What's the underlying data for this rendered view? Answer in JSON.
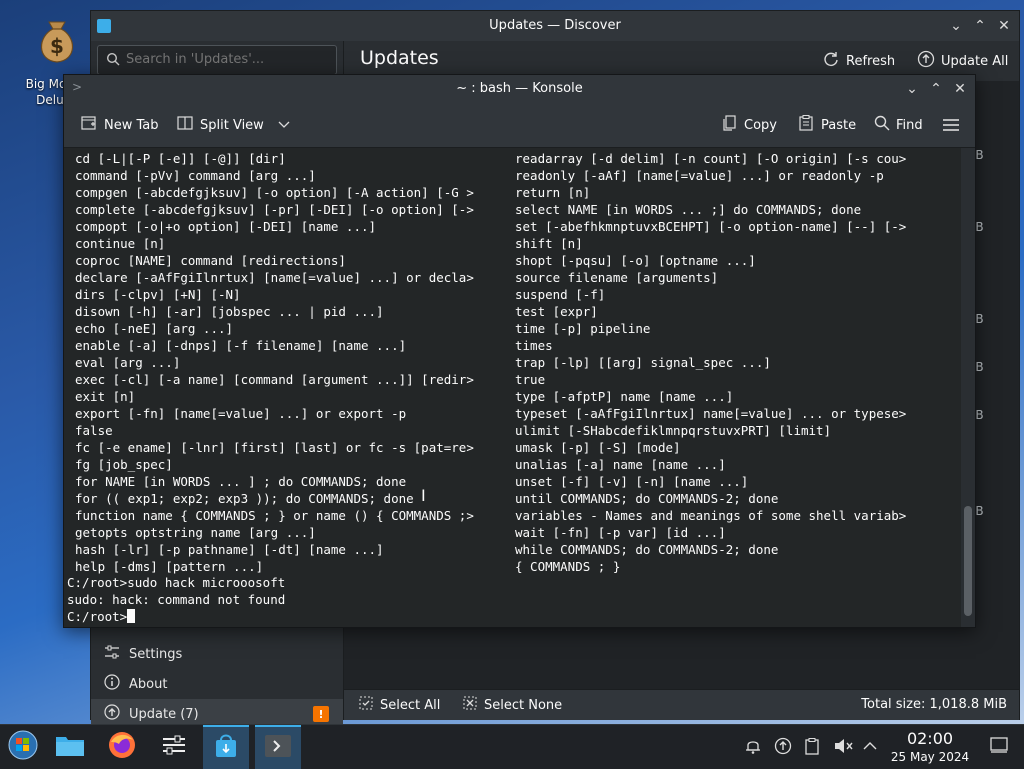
{
  "desktop": {
    "icon_label": "Big Money\nDeluxe"
  },
  "discover": {
    "title": "Updates — Discover",
    "search_placeholder": "Search in 'Updates'...",
    "header_title": "Updates",
    "refresh_label": "Refresh",
    "update_all_label": "Update All",
    "sidebar": {
      "settings_label": "Settings",
      "about_label": "About",
      "update_label": "Update (7)",
      "warning_glyph": "!"
    },
    "bottom": {
      "select_all_label": "Select All",
      "select_none_label": "Select None",
      "total_size": "Total size: 1,018.8 MiB"
    },
    "size_fragments": [
      "iB",
      "iB",
      "iB",
      "iB",
      "iB",
      "iB"
    ]
  },
  "konsole": {
    "title": "~ : bash — Konsole",
    "toolbar": {
      "new_tab": "New Tab",
      "split_view": "Split View",
      "copy": "Copy",
      "paste": "Paste",
      "find": "Find"
    },
    "col1": [
      "cd [-L|[-P [-e]] [-@]] [dir]",
      "command [-pVv] command [arg ...]",
      "compgen [-abcdefgjksuv] [-o option] [-A action] [-G >",
      "complete [-abcdefgjksuv] [-pr] [-DEI] [-o option] [->",
      "compopt [-o|+o option] [-DEI] [name ...]",
      "continue [n]",
      "coproc [NAME] command [redirections]",
      "declare [-aAfFgiIlnrtux] [name[=value] ...] or decla>",
      "dirs [-clpv] [+N] [-N]",
      "disown [-h] [-ar] [jobspec ... | pid ...]",
      "echo [-neE] [arg ...]",
      "enable [-a] [-dnps] [-f filename] [name ...]",
      "eval [arg ...]",
      "exec [-cl] [-a name] [command [argument ...]] [redir>",
      "exit [n]",
      "export [-fn] [name[=value] ...] or export -p",
      "false",
      "fc [-e ename] [-lnr] [first] [last] or fc -s [pat=re>",
      "fg [job_spec]",
      "for NAME [in WORDS ... ] ; do COMMANDS; done",
      "for (( exp1; exp2; exp3 )); do COMMANDS; done",
      "function name { COMMANDS ; } or name () { COMMANDS ;>",
      "getopts optstring name [arg ...]",
      "hash [-lr] [-p pathname] [-dt] [name ...]",
      "help [-dms] [pattern ...]"
    ],
    "col2": [
      "readarray [-d delim] [-n count] [-O origin] [-s cou>",
      "readonly [-aAf] [name[=value] ...] or readonly -p",
      "return [n]",
      "select NAME [in WORDS ... ;] do COMMANDS; done",
      "set [-abefhkmnptuvxBCEHPT] [-o option-name] [--] [->",
      "shift [n]",
      "shopt [-pqsu] [-o] [optname ...]",
      "source filename [arguments]",
      "suspend [-f]",
      "test [expr]",
      "time [-p] pipeline",
      "times",
      "trap [-lp] [[arg] signal_spec ...]",
      "true",
      "type [-afptP] name [name ...]",
      "typeset [-aAfFgiIlnrtux] name[=value] ... or typese>",
      "ulimit [-SHabcdefiklmnpqrstuvxPRT] [limit]",
      "umask [-p] [-S] [mode]",
      "unalias [-a] name [name ...]",
      "unset [-f] [-v] [-n] [name ...]",
      "until COMMANDS; do COMMANDS-2; done",
      "variables - Names and meanings of some shell variab>",
      "wait [-fn] [-p var] [id ...]",
      "while COMMANDS; do COMMANDS-2; done",
      "{ COMMANDS ; }"
    ],
    "prompt_lines": [
      "C:/root>sudo hack microoosoft",
      "sudo: hack: command not found",
      "C:/root>"
    ]
  },
  "taskbar": {
    "time": "02:00",
    "date": "25 May 2024"
  },
  "colors": {
    "accent": "#3daee9",
    "warning": "#f67400",
    "terminal_bg": "#232627",
    "window_bg": "#31363b"
  }
}
